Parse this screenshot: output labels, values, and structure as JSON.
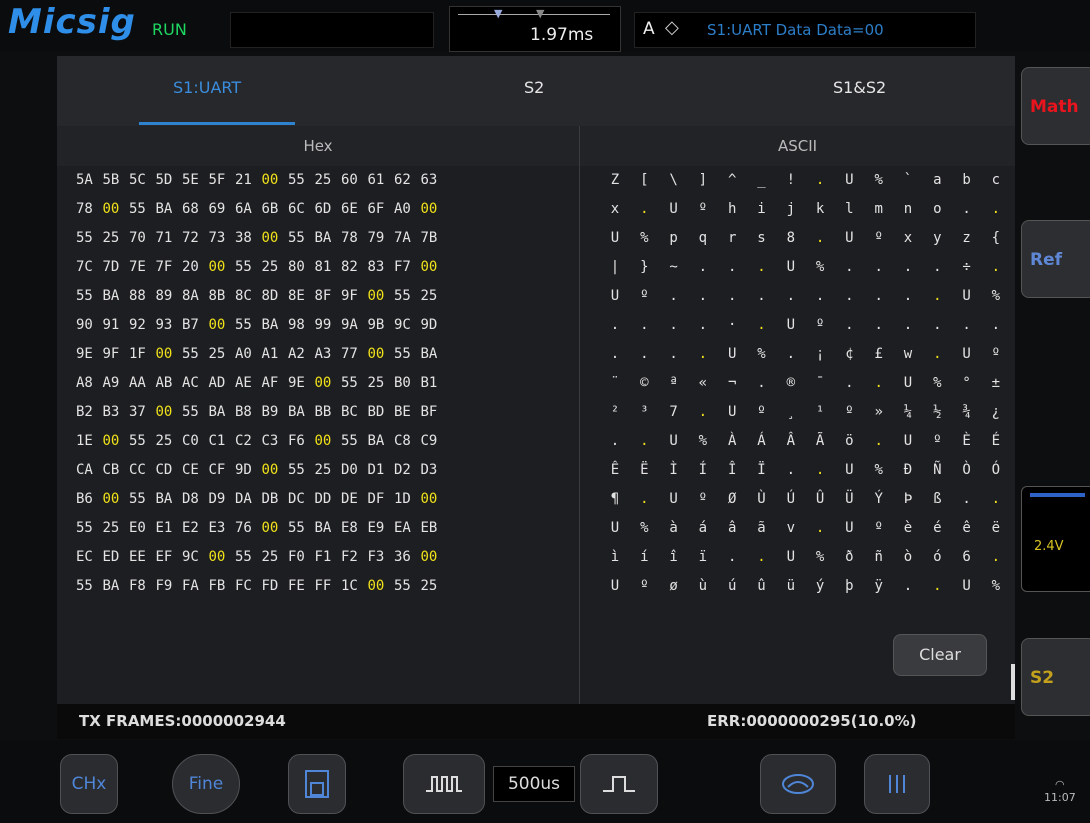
{
  "header": {
    "brand": "Micsig",
    "run_state": "RUN",
    "timebase": "1.97ms",
    "trigger_source": "A",
    "trigger_info": "S1:UART Data Data=00"
  },
  "tabs": [
    {
      "label": "S1:UART",
      "active": true
    },
    {
      "label": "S2",
      "active": false
    },
    {
      "label": "S1&S2",
      "active": false
    }
  ],
  "columns": {
    "hex": "Hex",
    "ascii": "ASCII"
  },
  "hex_rows": [
    [
      "5A",
      "5B",
      "5C",
      "5D",
      "5E",
      "5F",
      "21",
      "00",
      "55",
      "25",
      "60",
      "61",
      "62",
      "63"
    ],
    [
      "78",
      "00",
      "55",
      "BA",
      "68",
      "69",
      "6A",
      "6B",
      "6C",
      "6D",
      "6E",
      "6F",
      "A0",
      "00"
    ],
    [
      "55",
      "25",
      "70",
      "71",
      "72",
      "73",
      "38",
      "00",
      "55",
      "BA",
      "78",
      "79",
      "7A",
      "7B"
    ],
    [
      "7C",
      "7D",
      "7E",
      "7F",
      "20",
      "00",
      "55",
      "25",
      "80",
      "81",
      "82",
      "83",
      "F7",
      "00"
    ],
    [
      "55",
      "BA",
      "88",
      "89",
      "8A",
      "8B",
      "8C",
      "8D",
      "8E",
      "8F",
      "9F",
      "00",
      "55",
      "25"
    ],
    [
      "90",
      "91",
      "92",
      "93",
      "B7",
      "00",
      "55",
      "BA",
      "98",
      "99",
      "9A",
      "9B",
      "9C",
      "9D"
    ],
    [
      "9E",
      "9F",
      "1F",
      "00",
      "55",
      "25",
      "A0",
      "A1",
      "A2",
      "A3",
      "77",
      "00",
      "55",
      "BA"
    ],
    [
      "A8",
      "A9",
      "AA",
      "AB",
      "AC",
      "AD",
      "AE",
      "AF",
      "9E",
      "00",
      "55",
      "25",
      "B0",
      "B1"
    ],
    [
      "B2",
      "B3",
      "37",
      "00",
      "55",
      "BA",
      "B8",
      "B9",
      "BA",
      "BB",
      "BC",
      "BD",
      "BE",
      "BF"
    ],
    [
      "1E",
      "00",
      "55",
      "25",
      "C0",
      "C1",
      "C2",
      "C3",
      "F6",
      "00",
      "55",
      "BA",
      "C8",
      "C9"
    ],
    [
      "CA",
      "CB",
      "CC",
      "CD",
      "CE",
      "CF",
      "9D",
      "00",
      "55",
      "25",
      "D0",
      "D1",
      "D2",
      "D3"
    ],
    [
      "B6",
      "00",
      "55",
      "BA",
      "D8",
      "D9",
      "DA",
      "DB",
      "DC",
      "DD",
      "DE",
      "DF",
      "1D",
      "00"
    ],
    [
      "55",
      "25",
      "E0",
      "E1",
      "E2",
      "E3",
      "76",
      "00",
      "55",
      "BA",
      "E8",
      "E9",
      "EA",
      "EB"
    ],
    [
      "EC",
      "ED",
      "EE",
      "EF",
      "9C",
      "00",
      "55",
      "25",
      "F0",
      "F1",
      "F2",
      "F3",
      "36",
      "00"
    ],
    [
      "55",
      "BA",
      "F8",
      "F9",
      "FA",
      "FB",
      "FC",
      "FD",
      "FE",
      "FF",
      "1C",
      "00",
      "55",
      "25"
    ]
  ],
  "ascii_rows": [
    [
      "Z",
      "[",
      "\\",
      "]",
      "^",
      "_",
      "!",
      ".",
      "U",
      "%",
      "`",
      "a",
      "b",
      "c"
    ],
    [
      "x",
      ".",
      "U",
      "º",
      "h",
      "i",
      "j",
      "k",
      "l",
      "m",
      "n",
      "o",
      ".",
      "."
    ],
    [
      "U",
      "%",
      "p",
      "q",
      "r",
      "s",
      "8",
      ".",
      "U",
      "º",
      "x",
      "y",
      "z",
      "{"
    ],
    [
      "|",
      "}",
      "~",
      ".",
      ".",
      ".",
      "U",
      "%",
      ".",
      ".",
      ".",
      ".",
      "÷",
      "."
    ],
    [
      "U",
      "º",
      ".",
      ".",
      ".",
      ".",
      ".",
      ".",
      ".",
      ".",
      ".",
      ".",
      "U",
      "%"
    ],
    [
      ".",
      ".",
      ".",
      ".",
      "·",
      ".",
      "U",
      "º",
      ".",
      ".",
      ".",
      ".",
      ".",
      "."
    ],
    [
      ".",
      ".",
      ".",
      ".",
      "U",
      "%",
      ".",
      "¡",
      "¢",
      "£",
      "w",
      ".",
      "U",
      "º"
    ],
    [
      "¨",
      "©",
      "ª",
      "«",
      "¬",
      ".",
      "®",
      "¯",
      ".",
      ".",
      "U",
      "%",
      "°",
      "±"
    ],
    [
      "²",
      "³",
      "7",
      ".",
      "U",
      "º",
      "¸",
      "¹",
      "º",
      "»",
      "¼",
      "½",
      "¾",
      "¿"
    ],
    [
      ".",
      ".",
      "U",
      "%",
      "À",
      "Á",
      "Â",
      "Ã",
      "ö",
      ".",
      "U",
      "º",
      "È",
      "É"
    ],
    [
      "Ê",
      "Ë",
      "Ì",
      "Í",
      "Î",
      "Ï",
      ".",
      ".",
      "U",
      "%",
      "Ð",
      "Ñ",
      "Ò",
      "Ó"
    ],
    [
      "¶",
      ".",
      "U",
      "º",
      "Ø",
      "Ù",
      "Ú",
      "Û",
      "Ü",
      "Ý",
      "Þ",
      "ß",
      ".",
      "."
    ],
    [
      "U",
      "%",
      "à",
      "á",
      "â",
      "ã",
      "v",
      ".",
      "U",
      "º",
      "è",
      "é",
      "ê",
      "ë"
    ],
    [
      "ì",
      "í",
      "î",
      "ï",
      ".",
      ".",
      "U",
      "%",
      "ð",
      "ñ",
      "ò",
      "ó",
      "6",
      "."
    ],
    [
      "U",
      "º",
      "ø",
      "ù",
      "ú",
      "û",
      "ü",
      "ý",
      "þ",
      "ÿ",
      ".",
      ".",
      "U",
      "%"
    ]
  ],
  "clear_label": "Clear",
  "footer": {
    "tx_frames": "TX FRAMES:0000002944",
    "err": "ERR:0000000295(10.0%)"
  },
  "side": {
    "math_label": "Math",
    "ref_label": "Ref",
    "volt": "2.4V",
    "s2_label": "S2"
  },
  "bottom": {
    "chx_label": "CHx",
    "fine_label": "Fine",
    "timebase_value": "500us",
    "clock": "11:07"
  }
}
